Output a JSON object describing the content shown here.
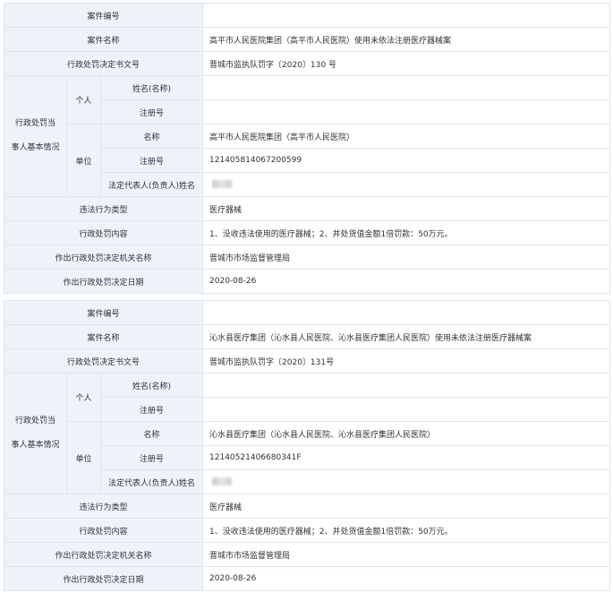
{
  "labels": {
    "case_no": "案件编号",
    "case_name": "案件名称",
    "decision_no": "行政处罚决定书文号",
    "party_info_line1": "行政处罚当",
    "party_info_line2": "事人基本情况",
    "individual": "个人",
    "name": "姓名(名称)",
    "reg_no": "注册号",
    "unit": "单位",
    "unit_name": "名称",
    "unit_reg_no": "注册号",
    "legal_rep": "法定代表人(负责人)姓名",
    "violation_type": "违法行为类型",
    "penalty_content": "行政处罚内容",
    "authority": "作出行政处罚决定机关名称",
    "decision_date": "作出行政处罚决定日期"
  },
  "records": [
    {
      "case_no": "",
      "case_name": "高平市人民医院集团（高平市人民医院）使用未依法注册医疗器械案",
      "decision_no": "晋城市监执队罚字〔2020〕130 号",
      "individual_name": "",
      "individual_reg_no": "",
      "unit_name": "高平市人民医院集团（高平市人民医院）",
      "unit_reg_no": "121405814067200599",
      "violation_type": "医疗器械",
      "penalty_content": "1、没收违法使用的医疗器械；2、并处货值金额1倍罚款：50万元。",
      "authority": "晋城市市场监督管理局",
      "decision_date": "2020-08-26"
    },
    {
      "case_no": "",
      "case_name": "沁水县医疗集团（沁水县人民医院、沁水县医疗集团人民医院）使用未依法注册医疗器械案",
      "decision_no": "晋城市监执队罚字〔2020〕131号",
      "individual_name": "",
      "individual_reg_no": "",
      "unit_name": "沁水县医疗集团（沁水县人民医院、沁水县医疗集团人民医院）",
      "unit_reg_no": "12140521406680341F",
      "violation_type": "医疗器械",
      "penalty_content": "1、没收违法使用的医疗器械；2、并处货值金额1倍罚款：50万元。",
      "authority": "晋城市市场监督管理局",
      "decision_date": "2020-08-26"
    }
  ]
}
